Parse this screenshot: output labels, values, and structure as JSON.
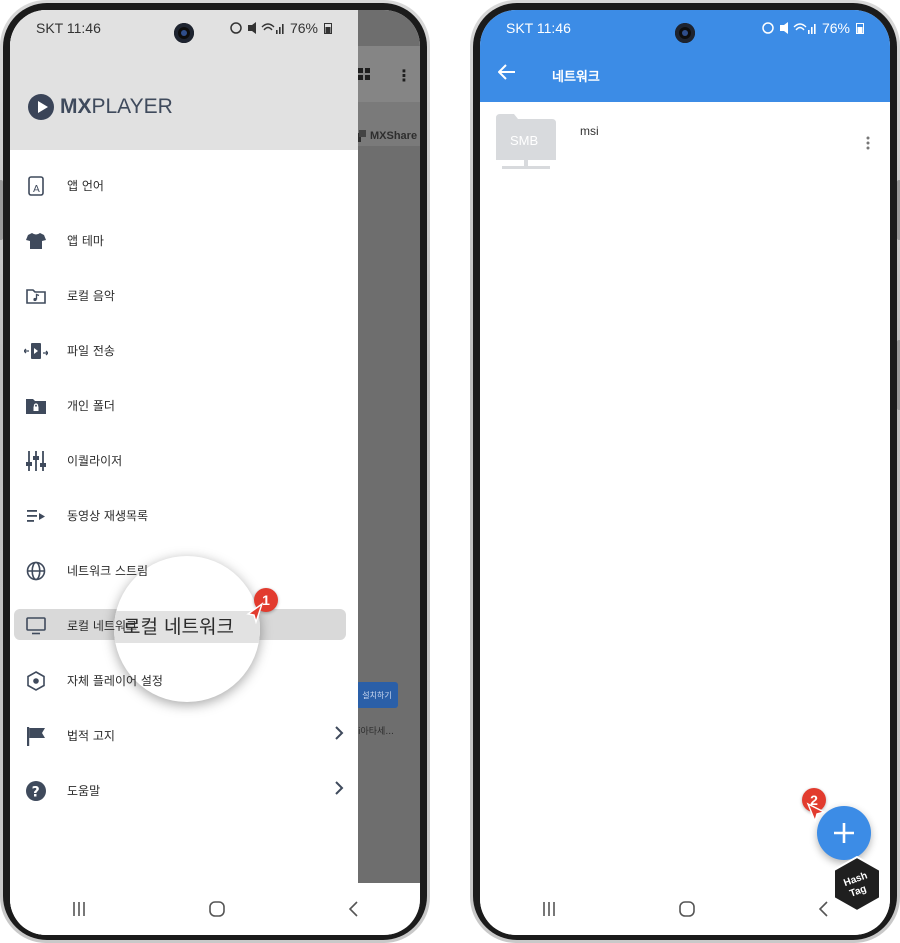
{
  "left_phone": {
    "status": {
      "carrier_time": "SKT 11:46",
      "battery": "76%"
    },
    "background_app": {
      "mxshare_label": "MXShare",
      "install_label": "설치하기",
      "sub_text": "i아타세..."
    },
    "logo": {
      "mx": "MX",
      "player": "PLAYER"
    },
    "menu": [
      {
        "label": "앱 언어",
        "icon": "language-icon"
      },
      {
        "label": "앱 테마",
        "icon": "tshirt-icon"
      },
      {
        "label": "로컬 음악",
        "icon": "music-folder-icon"
      },
      {
        "label": "파일 전송",
        "icon": "file-transfer-icon"
      },
      {
        "label": "개인 폴더",
        "icon": "locked-folder-icon"
      },
      {
        "label": "이퀄라이저",
        "icon": "equalizer-icon"
      },
      {
        "label": "동영상 재생목록",
        "icon": "playlist-icon"
      },
      {
        "label": "네트워크 스트림",
        "icon": "globe-icon"
      },
      {
        "label": "로컬 네트워크",
        "icon": "monitor-icon",
        "active": true
      },
      {
        "label": "자체 플레이어 설정",
        "icon": "hexagon-settings-icon"
      },
      {
        "label": "법적 고지",
        "icon": "flag-icon"
      },
      {
        "label": "도움말",
        "icon": "help-icon"
      }
    ],
    "magnifier_text": "로컬 네트워크",
    "step_badge": "1"
  },
  "right_phone": {
    "status": {
      "carrier_time": "SKT 11:46",
      "battery": "76%"
    },
    "title": "네트워크",
    "server": {
      "type_label": "SMB",
      "name": "msi"
    },
    "step_badge": "2"
  },
  "watermark": {
    "line1": "Hash",
    "line2": "Tag"
  },
  "colors": {
    "accent": "#3c8ce6",
    "badge": "#e23b2e",
    "icon": "#3f4a5c"
  }
}
